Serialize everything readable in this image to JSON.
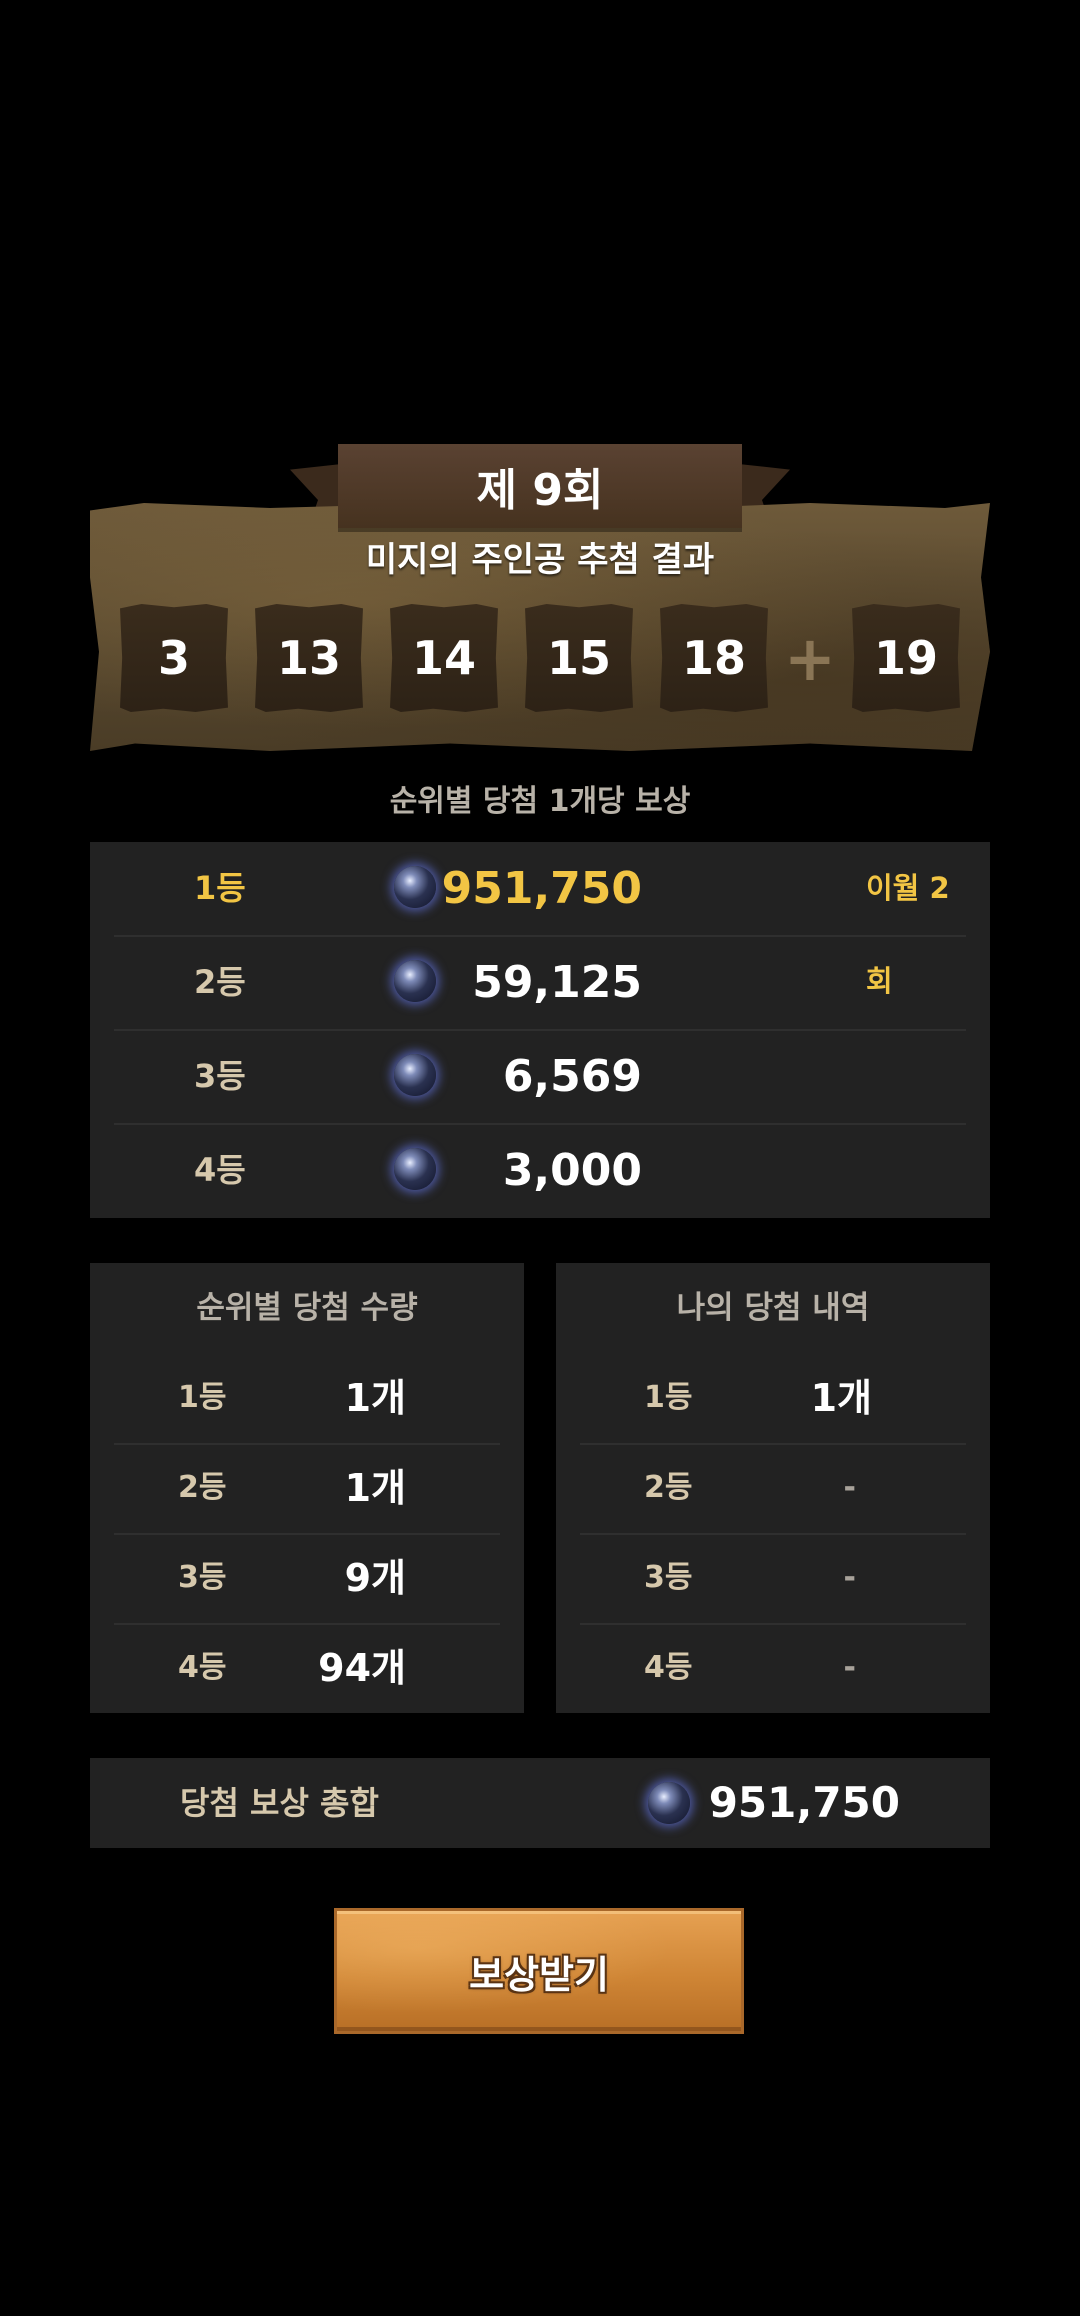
{
  "draw": {
    "round_label": "제 9회",
    "title": "미지의 주인공 추첨 결과",
    "numbers": [
      "3",
      "13",
      "14",
      "15",
      "18"
    ],
    "plus_symbol": "+",
    "bonus": "19"
  },
  "rewards": {
    "heading": "순위별 당첨 1개당 보상",
    "rows": [
      {
        "rank": "1등",
        "amount": "951,750",
        "note": "이월 2회"
      },
      {
        "rank": "2등",
        "amount": "59,125",
        "note": ""
      },
      {
        "rank": "3등",
        "amount": "6,569",
        "note": ""
      },
      {
        "rank": "4등",
        "amount": "3,000",
        "note": ""
      }
    ]
  },
  "win_counts": {
    "title": "순위별 당첨 수량",
    "rows": [
      {
        "rank": "1등",
        "value": "1개"
      },
      {
        "rank": "2등",
        "value": "1개"
      },
      {
        "rank": "3등",
        "value": "9개"
      },
      {
        "rank": "4등",
        "value": "94개"
      }
    ]
  },
  "my_history": {
    "title": "나의 당첨 내역",
    "rows": [
      {
        "rank": "1등",
        "value": "1개"
      },
      {
        "rank": "2등",
        "value": "-"
      },
      {
        "rank": "3등",
        "value": "-"
      },
      {
        "rank": "4등",
        "value": "-"
      }
    ]
  },
  "total": {
    "label": "당첨 보상 총합",
    "value": "951,750"
  },
  "claim_button": "보상받기",
  "colors": {
    "background": "#000000",
    "panel": "#222222",
    "gold": "#f2c544",
    "rank_text": "#d6c8ac",
    "button_orange": "#d88d3d"
  },
  "icons": {
    "currency": "crystal-orb-icon"
  }
}
